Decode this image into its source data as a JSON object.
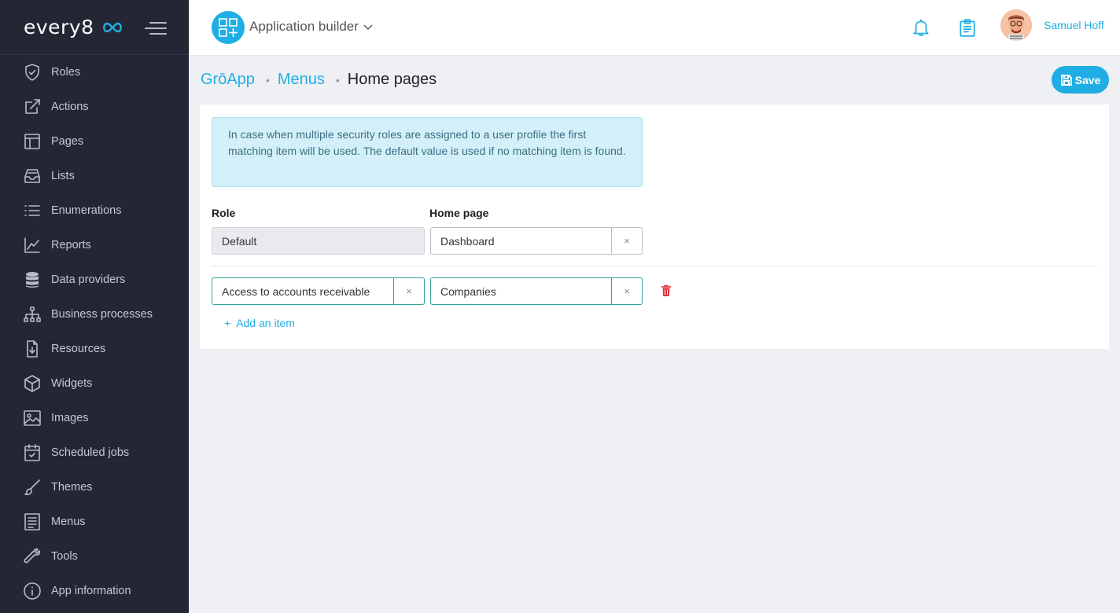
{
  "brand": {
    "name": "every8",
    "accent": "#1faee3",
    "sidebar_bg": "#232633"
  },
  "sidebar": {
    "items": [
      {
        "label": "Roles",
        "icon": "shield-icon"
      },
      {
        "label": "Actions",
        "icon": "external-link-icon"
      },
      {
        "label": "Pages",
        "icon": "layout-icon"
      },
      {
        "label": "Lists",
        "icon": "inbox-stack-icon"
      },
      {
        "label": "Enumerations",
        "icon": "list-icon"
      },
      {
        "label": "Reports",
        "icon": "line-chart-icon"
      },
      {
        "label": "Data providers",
        "icon": "database-icon"
      },
      {
        "label": "Business processes",
        "icon": "hierarchy-icon"
      },
      {
        "label": "Resources",
        "icon": "file-download-icon"
      },
      {
        "label": "Widgets",
        "icon": "cube-icon"
      },
      {
        "label": "Images",
        "icon": "image-icon"
      },
      {
        "label": "Scheduled jobs",
        "icon": "calendar-check-icon"
      },
      {
        "label": "Themes",
        "icon": "brush-icon"
      },
      {
        "label": "Menus",
        "icon": "menu-document-icon"
      },
      {
        "label": "Tools",
        "icon": "wrench-icon"
      },
      {
        "label": "App information",
        "icon": "info-icon"
      }
    ]
  },
  "header": {
    "app_title": "Application builder",
    "user_name": "Samuel Hoff"
  },
  "breadcrumb": {
    "app": "GrōApp",
    "section": "Menus",
    "current": "Home pages"
  },
  "toolbar": {
    "save_label": "Save"
  },
  "info_text": "In case when multiple security roles are assigned to a user profile the first matching item will be used. The default value is used if no matching item is found.",
  "columns": {
    "role": "Role",
    "home_page": "Home page"
  },
  "default_row": {
    "role": "Default",
    "home_page": "Dashboard"
  },
  "rows": [
    {
      "role": "Access to accounts receivable",
      "home_page": "Companies"
    }
  ],
  "clear_glyph": "×",
  "add_item_label": "Add an item",
  "add_item_glyph": "+"
}
